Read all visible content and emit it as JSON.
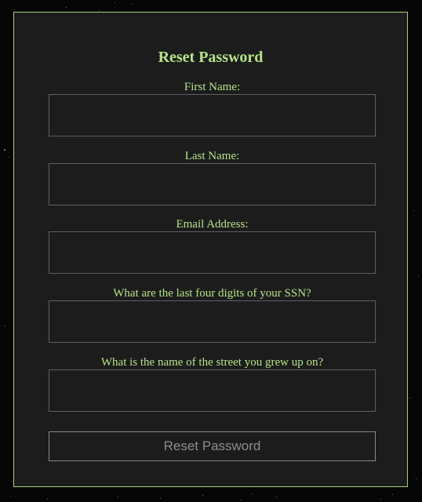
{
  "form": {
    "title": "Reset Password",
    "fields": [
      {
        "label": "First Name:",
        "value": "",
        "placeholder": ""
      },
      {
        "label": "Last Name:",
        "value": "",
        "placeholder": ""
      },
      {
        "label": "Email Address:",
        "value": "",
        "placeholder": ""
      },
      {
        "label": "What are the last four digits of your SSN?",
        "value": "",
        "placeholder": ""
      },
      {
        "label": "What is the name of the street you grew up on?",
        "value": "",
        "placeholder": ""
      }
    ],
    "submit_label": "Reset Password"
  },
  "colors": {
    "accent": "#b7e389",
    "panel_background": "#1c1c1c",
    "page_background": "#060606",
    "input_border": "#5f5f68"
  }
}
